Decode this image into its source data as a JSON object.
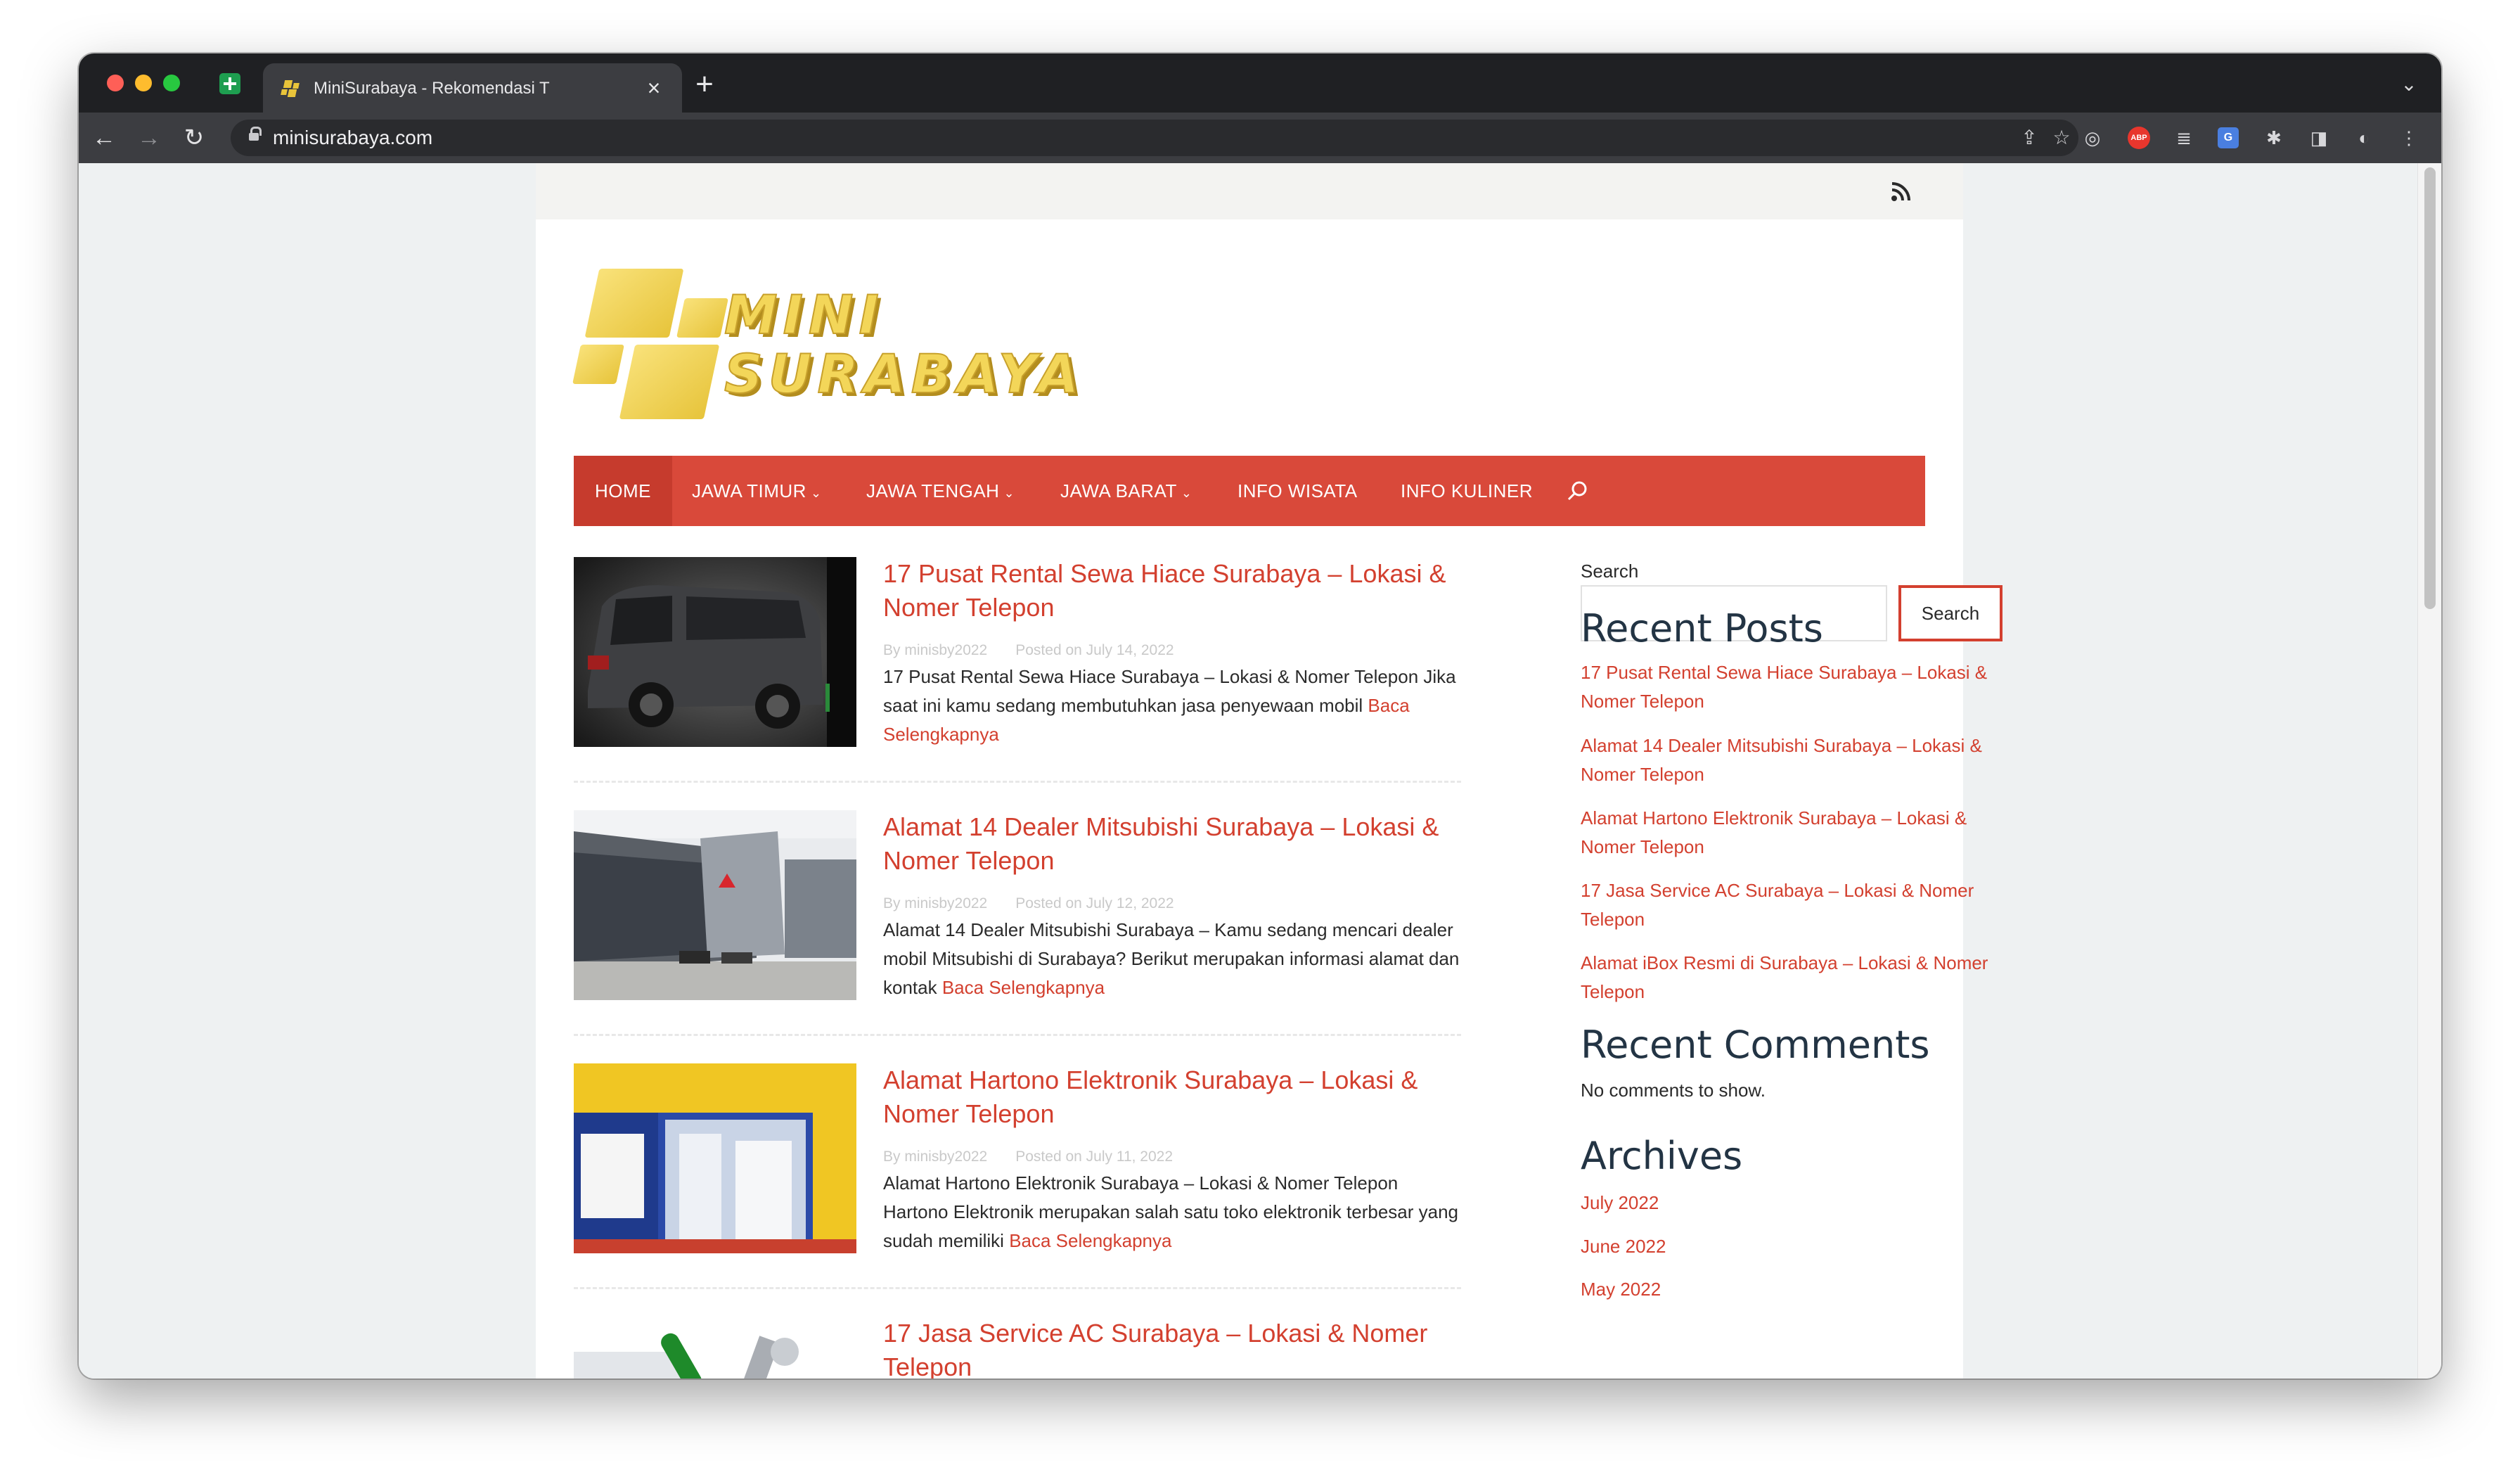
{
  "browser": {
    "tab_title": "MiniSurabaya - Rekomendasi T",
    "url": "minisurabaya.com",
    "new_tab_symbol": "+",
    "close_symbol": "×"
  },
  "colors": {
    "accent": "#d9493a",
    "link": "#d3402f",
    "heading": "#233444"
  },
  "site": {
    "logo_line1": "MINI",
    "logo_line2": "SURABAYA"
  },
  "menu": {
    "items": [
      {
        "label": "HOME",
        "dropdown": false
      },
      {
        "label": "JAWA TIMUR",
        "dropdown": true
      },
      {
        "label": "JAWA TENGAH",
        "dropdown": true
      },
      {
        "label": "JAWA BARAT",
        "dropdown": true
      },
      {
        "label": "INFO WISATA",
        "dropdown": false
      },
      {
        "label": "INFO KULINER",
        "dropdown": false
      }
    ],
    "caret": "⌄"
  },
  "posts": [
    {
      "title": "17 Pusat Rental Sewa Hiace Surabaya – Lokasi & Nomer Telepon",
      "author": "By minisby2022",
      "date": "Posted on July 14, 2022",
      "excerpt": "17 Pusat Rental Sewa Hiace Surabaya – Lokasi & Nomer Telepon Jika saat ini kamu sedang membutuhkan jasa penyewaan mobil",
      "read_more": "Baca Selengkapnya"
    },
    {
      "title": "Alamat 14 Dealer Mitsubishi Surabaya – Lokasi & Nomer Telepon",
      "author": "By minisby2022",
      "date": "Posted on July 12, 2022",
      "excerpt": "Alamat 14 Dealer Mitsubishi Surabaya – Kamu sedang mencari dealer mobil Mitsubishi di Surabaya? Berikut merupakan informasi alamat dan kontak",
      "read_more": "Baca Selengkapnya"
    },
    {
      "title": "Alamat Hartono Elektronik Surabaya – Lokasi & Nomer Telepon",
      "author": "By minisby2022",
      "date": "Posted on July 11, 2022",
      "excerpt": "Alamat Hartono Elektronik Surabaya – Lokasi & Nomer Telepon Hartono Elektronik merupakan salah satu toko elektronik terbesar yang sudah memiliki",
      "read_more": "Baca Selengkapnya"
    },
    {
      "title": "17 Jasa Service AC Surabaya – Lokasi & Nomer Telepon"
    }
  ],
  "sidebar": {
    "search_label": "Search",
    "search_button": "Search",
    "recent_posts_heading": "Recent Posts",
    "recent_posts": [
      "17 Pusat Rental Sewa Hiace Surabaya – Lokasi & Nomer Telepon",
      "Alamat 14 Dealer Mitsubishi Surabaya – Lokasi & Nomer Telepon",
      "Alamat Hartono Elektronik Surabaya – Lokasi & Nomer Telepon",
      "17 Jasa Service AC Surabaya – Lokasi & Nomer Telepon",
      "Alamat iBox Resmi di Surabaya – Lokasi & Nomer Telepon"
    ],
    "recent_comments_heading": "Recent Comments",
    "no_comments": "No comments to show.",
    "archives_heading": "Archives",
    "archives": [
      "July 2022",
      "June 2022",
      "May 2022"
    ]
  }
}
